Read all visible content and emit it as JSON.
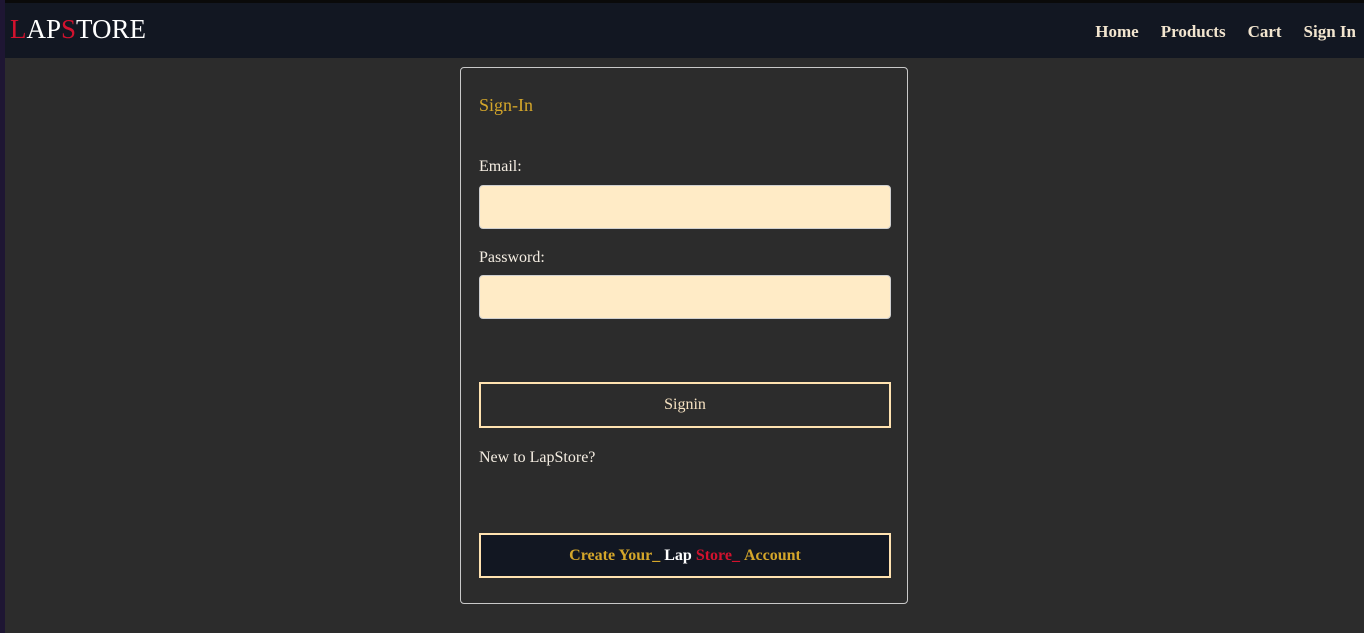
{
  "brand": {
    "parts": [
      "L",
      "AP",
      "S",
      "TORE"
    ]
  },
  "nav": {
    "home": "Home",
    "products": "Products",
    "cart": "Cart",
    "signin": "Sign In"
  },
  "form": {
    "title": "Sign-In",
    "email_label": "Email:",
    "email_value": "",
    "password_label": "Password:",
    "password_value": "",
    "submit_label": "Signin",
    "new_text": "New to LapStore?",
    "create": {
      "part1": "Create Your_ ",
      "part2": "Lap ",
      "part3": "Store_ ",
      "part4": "Account"
    }
  },
  "colors": {
    "accent_gold": "#d4a62a",
    "brand_red": "#d2122e",
    "input_bg": "#ffebc6",
    "header_bg": "#121722",
    "page_bg": "#2c2c2c"
  }
}
